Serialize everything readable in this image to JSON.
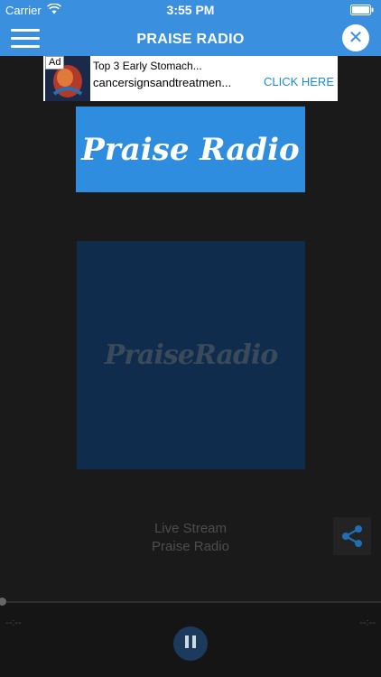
{
  "status_bar": {
    "carrier": "Carrier",
    "time": "3:55 PM"
  },
  "header": {
    "title": "PRAISE RADIO",
    "menu_icon": "hamburger-menu-icon",
    "close_icon": "close-icon",
    "close_symbol": "✕"
  },
  "ad": {
    "badge": "Ad",
    "headline": "Top 3 Early Stomach...",
    "domain": "cancersignsandtreatmen...",
    "cta": "CLICK HERE"
  },
  "logo": {
    "text": "Praise Radio"
  },
  "album_art": {
    "text": "PraiseRadio"
  },
  "stream": {
    "title": "Live Stream",
    "subtitle": "Praise Radio"
  },
  "player": {
    "elapsed": "--:--",
    "remaining": "--:--",
    "state": "playing",
    "progress": 0
  },
  "colors": {
    "accent": "#3a8fde",
    "background": "#1a1a1a"
  }
}
